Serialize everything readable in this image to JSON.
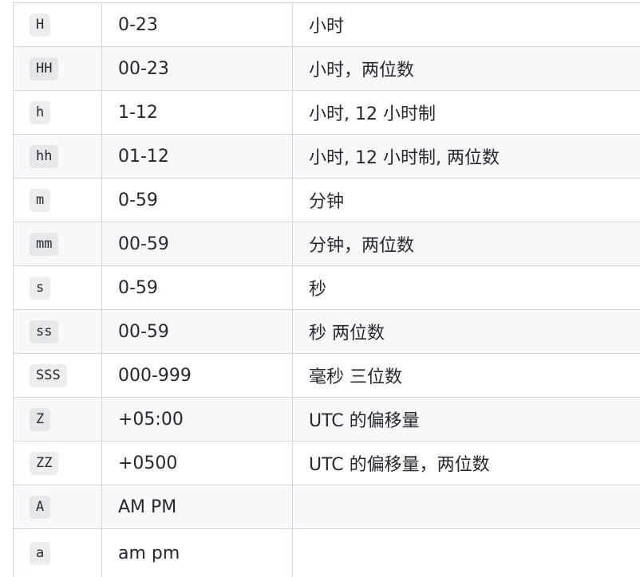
{
  "rows": [
    {
      "token": "H",
      "range": "0-23",
      "desc": "小时"
    },
    {
      "token": "HH",
      "range": "00-23",
      "desc": "小时，两位数"
    },
    {
      "token": "h",
      "range": "1-12",
      "desc": "小时, 12 小时制"
    },
    {
      "token": "hh",
      "range": "01-12",
      "desc": "小时, 12 小时制, 两位数"
    },
    {
      "token": "m",
      "range": "0-59",
      "desc": "分钟"
    },
    {
      "token": "mm",
      "range": "00-59",
      "desc": "分钟，两位数"
    },
    {
      "token": "s",
      "range": "0-59",
      "desc": "秒"
    },
    {
      "token": "ss",
      "range": "00-59",
      "desc": "秒 两位数"
    },
    {
      "token": "SSS",
      "range": "000-999",
      "desc": "毫秒 三位数"
    },
    {
      "token": "Z",
      "range": "+05:00",
      "desc": "UTC 的偏移量"
    },
    {
      "token": "ZZ",
      "range": "+0500",
      "desc": "UTC 的偏移量，两位数"
    },
    {
      "token": "A",
      "range": "AM PM",
      "desc": ""
    },
    {
      "token": "a",
      "range": "am pm",
      "desc": ""
    }
  ]
}
